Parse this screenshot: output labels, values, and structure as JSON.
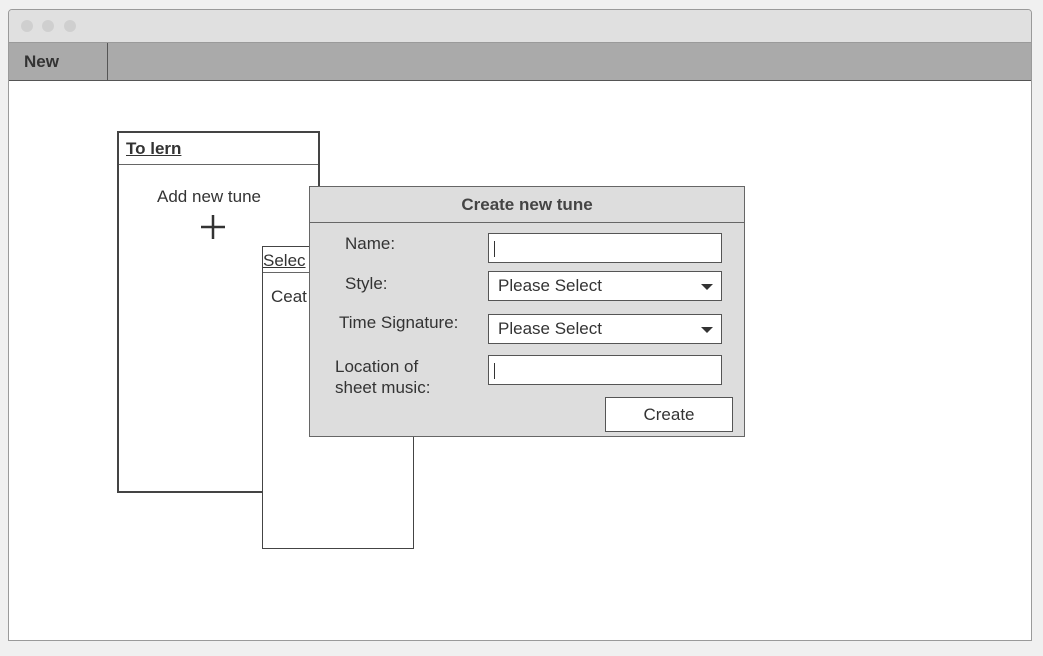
{
  "tabs": {
    "new_label": "New"
  },
  "to_lern_panel": {
    "title": "To lern",
    "add_new_tune_label": "Add new tune",
    "add_icon": "plus-icon"
  },
  "select_panel": {
    "title": "Selec",
    "item": "Ceat"
  },
  "dialog": {
    "title": "Create new tune",
    "name_label": "Name:",
    "name_value": "",
    "style_label": "Style:",
    "style_value": "Please Select",
    "time_signature_label": "Time Signature:",
    "time_signature_value": "Please Select",
    "location_label_line1": "Location of",
    "location_label_line2": "sheet music:",
    "location_value": "",
    "create_button": "Create"
  }
}
